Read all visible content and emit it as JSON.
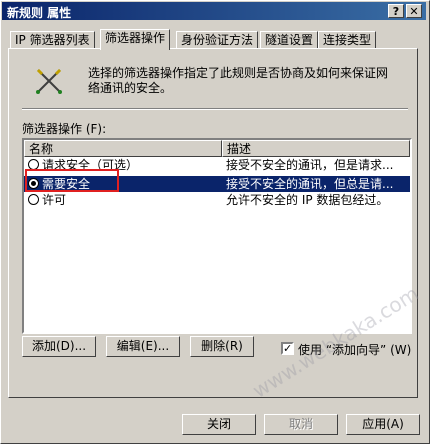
{
  "window": {
    "title": "新规则 属性",
    "help_glyph": "?",
    "close_glyph": "✕"
  },
  "tabs": [
    {
      "label": "IP 筛选器列表",
      "active": false
    },
    {
      "label": "筛选器操作",
      "active": true
    },
    {
      "label": "身份验证方法",
      "active": false
    },
    {
      "label": "隧道设置",
      "active": false
    },
    {
      "label": "连接类型",
      "active": false
    }
  ],
  "description": "选择的筛选器操作指定了此规则是否协商及如何来保证网络通讯的安全。",
  "list_label": "筛选器操作 (F):",
  "columns": [
    "名称",
    "描述"
  ],
  "rows": [
    {
      "name": "请求安全（可选）",
      "desc": "接受不安全的通讯，但是请求...",
      "checked": false,
      "selected": false
    },
    {
      "name": "需要安全",
      "desc": "接受不安全的通讯，但总是请...",
      "checked": true,
      "selected": true
    },
    {
      "name": "许可",
      "desc": "允许不安全的 IP 数据包经过。",
      "checked": false,
      "selected": false
    }
  ],
  "buttons": {
    "add": "添加(D)...",
    "edit": "编辑(E)...",
    "remove": "删除(R)",
    "wizard_label": "使用 “添加向导” (W)",
    "wizard_checked": true,
    "close": "关闭",
    "cancel": "取消",
    "apply": "应用(A)"
  },
  "watermark": "www.webkaka.com"
}
